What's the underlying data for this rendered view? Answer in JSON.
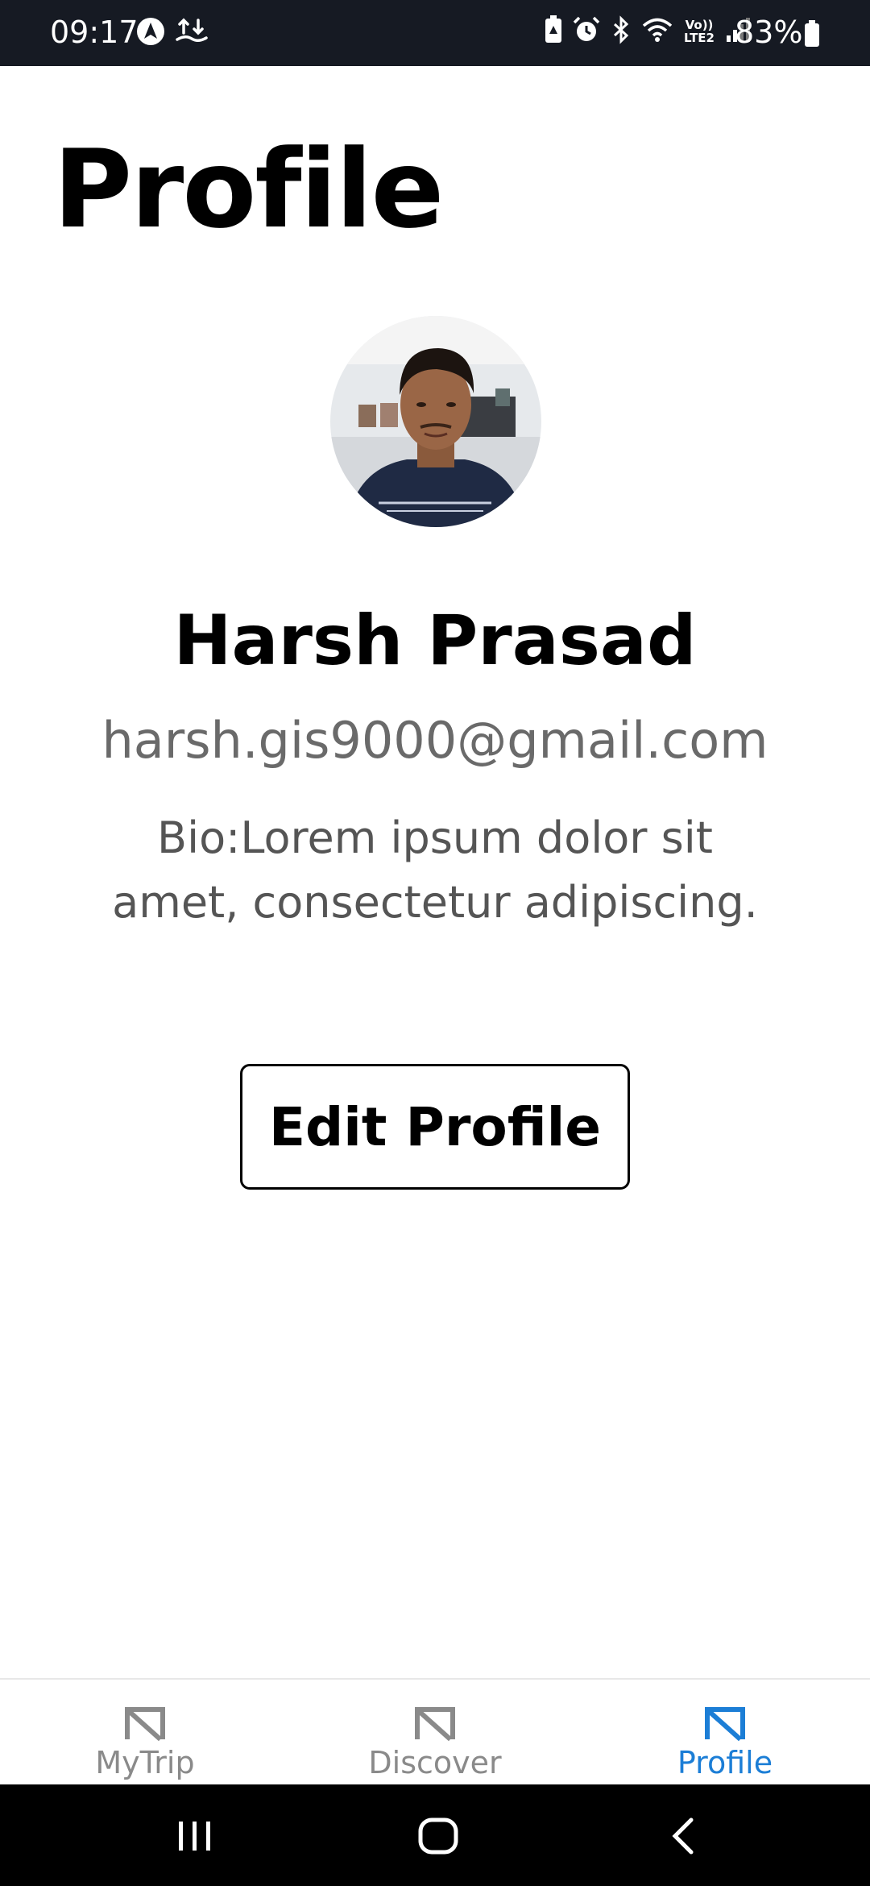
{
  "status_bar": {
    "time": "09:17",
    "battery": "83%",
    "left_icons": [
      "navigation-app-icon",
      "data-transfer-icon"
    ],
    "right_icons": [
      "battery-saver-icon",
      "alarm-icon",
      "bluetooth-icon",
      "wifi-icon",
      "volte-lte2-icon",
      "signal-icon"
    ]
  },
  "page": {
    "title": "Profile"
  },
  "profile": {
    "name": "Harsh Prasad",
    "email": "harsh.gis9000@gmail.com",
    "bio": "Bio:Lorem ipsum dolor sit amet, consectetur adipiscing.",
    "volte_text": "Vo)) LTE2"
  },
  "actions": {
    "edit_label": "Edit Profile"
  },
  "tabs": [
    {
      "label": "MyTrip",
      "icon": "mytrip-icon",
      "active": false
    },
    {
      "label": "Discover",
      "icon": "discover-icon",
      "active": false
    },
    {
      "label": "Profile",
      "icon": "profile-icon",
      "active": true
    }
  ],
  "colors": {
    "active_tab": "#1c7ed6",
    "inactive_tab": "#8a8a8a",
    "status_bar_bg": "#161a23"
  }
}
